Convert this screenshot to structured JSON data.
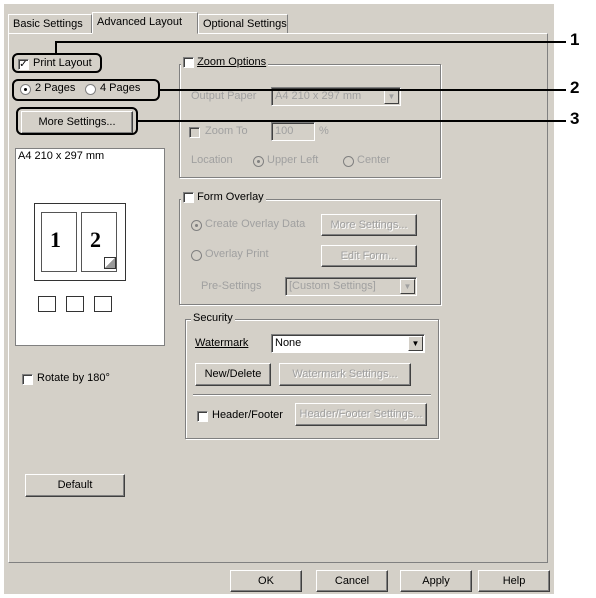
{
  "tabs": [
    {
      "label": "Basic Settings",
      "active": false
    },
    {
      "label": "Advanced Layout",
      "active": true
    },
    {
      "label": "Optional Settings",
      "active": false
    }
  ],
  "print_layout": {
    "label": "Print Layout",
    "checked": true,
    "options": [
      {
        "label": "2 Pages",
        "selected": true
      },
      {
        "label": "4 Pages",
        "selected": false
      }
    ],
    "more_settings": "More Settings..."
  },
  "preview": {
    "paper_label": "A4 210 x 297 mm",
    "page_numbers": [
      "1",
      "2"
    ]
  },
  "rotate": {
    "label": "Rotate by 180°",
    "checked": false
  },
  "default_button": "Default",
  "zoom": {
    "label": "Zoom Options",
    "checked": false,
    "output_paper_label": "Output Paper",
    "output_paper_value": "A4 210 x 297 mm",
    "zoom_to_label": "Zoom To",
    "zoom_value": "100",
    "zoom_unit": "%",
    "location_label": "Location",
    "upper_left": "Upper Left",
    "center": "Center"
  },
  "form_overlay": {
    "label": "Form Overlay",
    "checked": false,
    "create_label": "Create Overlay Data",
    "more_settings": "More Settings...",
    "overlay_print_label": "Overlay Print",
    "edit_form": "Edit Form...",
    "pre_settings_label": "Pre-Settings",
    "pre_settings_value": "[Custom Settings]"
  },
  "security": {
    "title": "Security",
    "watermark_label": "Watermark",
    "watermark_value": "None",
    "new_delete": "New/Delete",
    "watermark_settings": "Watermark Settings...",
    "header_footer_label": "Header/Footer",
    "header_footer_checked": false,
    "header_footer_settings": "Header/Footer Settings..."
  },
  "footer_buttons": {
    "ok": "OK",
    "cancel": "Cancel",
    "apply": "Apply",
    "help": "Help"
  },
  "callouts": [
    "1",
    "2",
    "3"
  ]
}
